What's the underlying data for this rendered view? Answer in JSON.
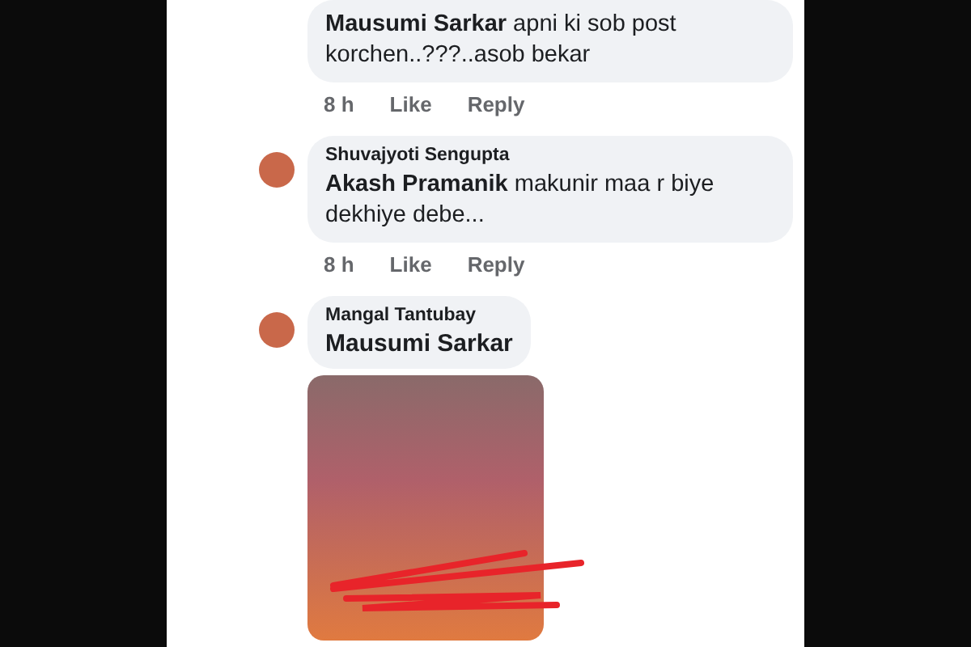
{
  "comments": [
    {
      "text": "**Mausumi Sarkar** apni ki sob post korchen..???..asob bekar",
      "time": "8 h",
      "like": "Like",
      "reply": "Reply"
    },
    {
      "author": "Shuvajyoti Sengupta",
      "text": "**Akash Pramanik** makunir maa r biye dekhiye debe...",
      "time": "8 h",
      "like": "Like",
      "reply": "Reply"
    },
    {
      "author": "Mangal Tantubay",
      "mention": "Mausumi Sarkar",
      "attachment": {
        "kind": "photo"
      }
    }
  ]
}
